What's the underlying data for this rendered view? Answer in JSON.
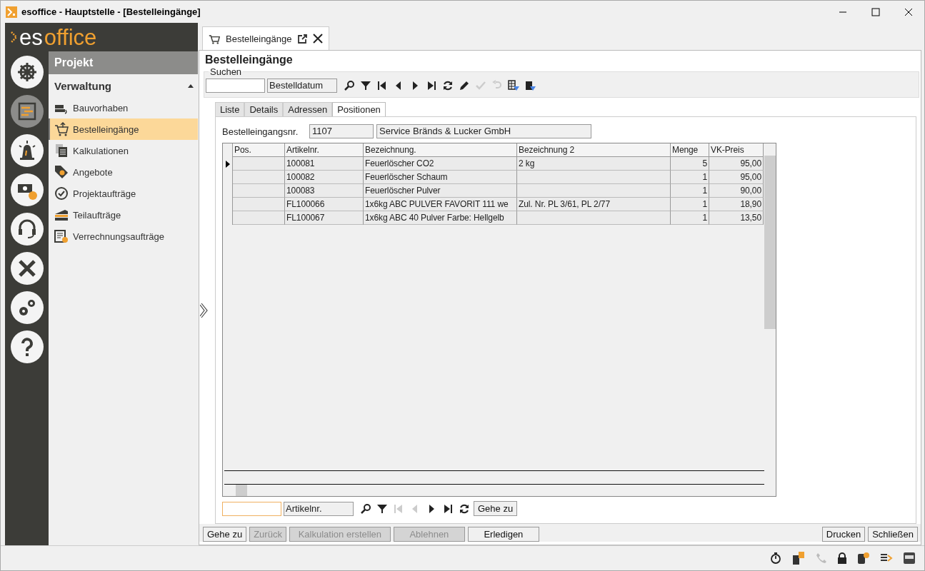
{
  "window": {
    "title": "esoffice - Hauptstelle - [Bestelleingänge]"
  },
  "logo": {
    "prefix": "es",
    "suffix": "office"
  },
  "rail": [
    {
      "selected": false
    },
    {
      "selected": true
    },
    {
      "selected": false
    },
    {
      "selected": false
    },
    {
      "selected": false
    },
    {
      "selected": false
    },
    {
      "selected": false
    },
    {
      "selected": false
    }
  ],
  "nav": {
    "title": "Projekt",
    "section": {
      "label": "Verwaltung",
      "expanded": true
    },
    "items": [
      {
        "label": "Bauvorhaben",
        "selected": false
      },
      {
        "label": "Bestelleingänge",
        "selected": true
      },
      {
        "label": "Kalkulationen",
        "selected": false
      },
      {
        "label": "Angebote",
        "selected": false
      },
      {
        "label": "Projektaufträge",
        "selected": false
      },
      {
        "label": "Teilaufträge",
        "selected": false
      },
      {
        "label": "Verrechnungsaufträge",
        "selected": false
      }
    ]
  },
  "doc_tab": {
    "label": "Bestelleingänge"
  },
  "page_title": "Bestelleingänge",
  "search": {
    "legend": "Suchen",
    "sort_field": "Bestelldatum",
    "toolbar": [
      {
        "disabled": false
      },
      {
        "disabled": false
      },
      {
        "disabled": false
      },
      {
        "disabled": false
      },
      {
        "disabled": false
      },
      {
        "disabled": false
      },
      {
        "disabled": false
      },
      {
        "disabled": false
      },
      {
        "disabled": true
      },
      {
        "disabled": true
      },
      {
        "disabled": false
      },
      {
        "disabled": false
      }
    ]
  },
  "tabs": [
    {
      "label": "Liste",
      "selected": false
    },
    {
      "label": "Details",
      "selected": false
    },
    {
      "label": "Adressen",
      "selected": false
    },
    {
      "label": "Positionen",
      "selected": true
    }
  ],
  "order": {
    "label": "Bestelleingangsnr.",
    "number": "1107",
    "supplier": "Service Bränds & Lucker GmbH"
  },
  "table": {
    "columns": [
      "Pos.",
      "Artikelnr.",
      "Bezeichnung.",
      "Bezeichnung 2",
      "Menge",
      "VK-Preis"
    ],
    "rows": [
      {
        "current": true,
        "cells": [
          "",
          "100081",
          "Feuerlöscher CO2",
          "2 kg",
          "5",
          "95,00"
        ]
      },
      {
        "current": false,
        "cells": [
          "",
          "100082",
          "Feuerlöscher Schaum",
          "",
          "1",
          "95,00"
        ]
      },
      {
        "current": false,
        "cells": [
          "",
          "100083",
          "Feuerlöscher Pulver",
          "",
          "1",
          "90,00"
        ]
      },
      {
        "current": false,
        "cells": [
          "",
          "FL100066",
          "1x6kg ABC PULVER FAVORIT 111 we",
          "Zul. Nr. PL 3/61, PL 2/77",
          "1",
          "18,90"
        ]
      },
      {
        "current": false,
        "cells": [
          "",
          "FL100067",
          "1x6kg ABC 40 Pulver Farbe: Hellgelb",
          "",
          "1",
          "13,50"
        ]
      }
    ]
  },
  "grid_search": {
    "sort_field": "Artikelnr.",
    "toolbar": [
      {
        "disabled": false
      },
      {
        "disabled": false
      },
      {
        "disabled": true
      },
      {
        "disabled": true
      },
      {
        "disabled": false
      },
      {
        "disabled": false
      },
      {
        "disabled": false
      }
    ],
    "goto": "Gehe zu"
  },
  "actions": [
    {
      "label": "Gehe zu",
      "disabled": false
    },
    {
      "label": "Zurück",
      "disabled": true
    },
    {
      "label": "Kalkulation erstellen",
      "disabled": true
    },
    {
      "label": "Ablehnen",
      "disabled": true
    },
    {
      "label": "Erledigen",
      "disabled": false
    }
  ],
  "right_actions": [
    {
      "label": "Drucken",
      "disabled": false
    },
    {
      "label": "Schließen",
      "disabled": false
    }
  ]
}
